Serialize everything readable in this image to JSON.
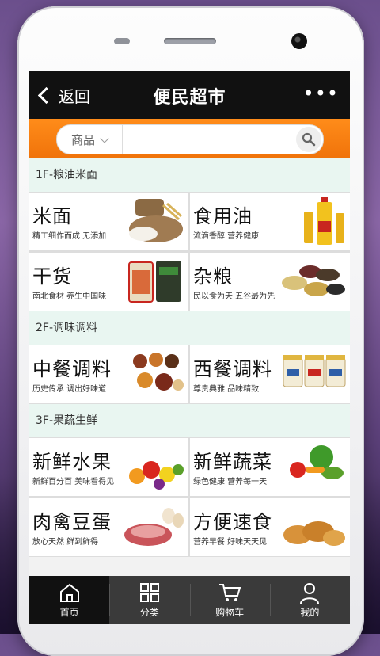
{
  "header": {
    "back_label": "返回",
    "title": "便民超市",
    "more_label": "•••"
  },
  "search": {
    "scope_label": "商品",
    "placeholder": ""
  },
  "floors": [
    {
      "title": "1F-粮油米面",
      "items": [
        {
          "name": "米面",
          "desc": "精工细作而成  无添加",
          "icon": "rice-sack-image"
        },
        {
          "name": "食用油",
          "desc": "流滴香醇  营养健康",
          "icon": "cooking-oil-image"
        },
        {
          "name": "干货",
          "desc": "南北食材  养生中国味",
          "icon": "dried-goods-image"
        },
        {
          "name": "杂粮",
          "desc": "民以食为天  五谷最为先",
          "icon": "grains-image"
        }
      ]
    },
    {
      "title": "2F-调味调料",
      "items": [
        {
          "name": "中餐调料",
          "desc": "历史传承  调出好味道",
          "icon": "chinese-spices-image"
        },
        {
          "name": "西餐调料",
          "desc": "尊贵典雅  品味精致",
          "icon": "western-sauce-image"
        }
      ]
    },
    {
      "title": "3F-果蔬生鲜",
      "items": [
        {
          "name": "新鲜水果",
          "desc": "新鲜百分百  美味看得见",
          "icon": "fruit-image"
        },
        {
          "name": "新鲜蔬菜",
          "desc": "绿色健康  营养每一天",
          "icon": "vegetable-image"
        },
        {
          "name": "肉禽豆蛋",
          "desc": "放心天然  鲜到鲜得",
          "icon": "meat-egg-image"
        },
        {
          "name": "方便速食",
          "desc": "营养早餐  好味天天见",
          "icon": "bread-image"
        }
      ]
    }
  ],
  "tabs": [
    {
      "label": "首页",
      "icon": "home-icon",
      "active": true
    },
    {
      "label": "分类",
      "icon": "grid-icon",
      "active": false
    },
    {
      "label": "购物车",
      "icon": "cart-icon",
      "active": false
    },
    {
      "label": "我的",
      "icon": "user-icon",
      "active": false
    }
  ],
  "colors": {
    "header_bg": "#111111",
    "search_bg": "#f0730a",
    "floor_bg": "#e9f6f1",
    "tab_bg": "#3a3a3a"
  }
}
